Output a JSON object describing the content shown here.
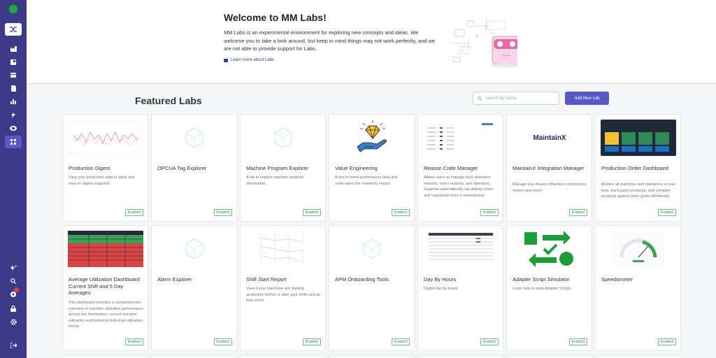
{
  "banner": {
    "title": "Welcome to MM Labs!",
    "text": "MM Labs is an experimental environment for exploring new concepts and ideas. We welcome you to take a look around, but keep in mind things may not work perfectly, and we are not able to provide support for Labs.",
    "learn_more": "Learn more about Labs"
  },
  "featured": {
    "title": "Featured Labs",
    "search_placeholder": "Search by Name",
    "add_button": "Add New Lab"
  },
  "colors": {
    "sidebar": "#3d3a8a",
    "accent": "#5a57c6",
    "enabled": "#2f8f4e"
  },
  "cards": [
    {
      "title": "Production Digest",
      "desc": "View your production data in quick and easy-to-digest snapshot.",
      "status": "Enabled"
    },
    {
      "title": "OPCUA Tag Explorer",
      "desc": "",
      "status": "Enabled"
    },
    {
      "title": "Machine Program Explorer",
      "desc": "A lab to explore machine program information.",
      "status": "Enabled"
    },
    {
      "title": "Value Engineering",
      "desc": "A tool to trend performance data and understand the monetary impact",
      "status": "Enabled"
    },
    {
      "title": "Reason Code Manager",
      "desc": "Allows users to manage their downtime reasons, reject reasons, and operators. Supports automatically calculating colors and copy/paste from a spreadsheet.",
      "status": "Enabled"
    },
    {
      "title": "MaintainX Integration Manager",
      "desc": "Manage your Asset&lt;&gt;Machine connections, meters and more!",
      "status": "Enabled"
    },
    {
      "title": "Production Order Dashboard",
      "desc": "Monitor all machines and operations in real-time, track parts produced, and compare progress against parts goals effortlessly.",
      "status": "Enabled"
    },
    {
      "title": "Average Utilization Dashboard: Current Shift and 5 Day Averages",
      "desc": "This dashboard provides a comprehensive overview of machine utilization performance across two timeframes: current real-time utilization and historical shift-level utilization trends",
      "status": "Enabled"
    },
    {
      "title": "Alarm Explorer",
      "desc": "",
      "status": "Enabled"
    },
    {
      "title": "Shift Start Report",
      "desc": "View if your machines are starting production before or after your shifts and by how much",
      "status": "Enabled"
    },
    {
      "title": "APM Onboarding Tools",
      "desc": "",
      "status": "Enabled"
    },
    {
      "title": "Day By Hours",
      "desc": "Digital day by board",
      "status": "Enabled"
    },
    {
      "title": "Adapter Script Simulator",
      "desc": "Learn how to write Adapter Scripts",
      "status": "Enabled"
    },
    {
      "title": "Speedometer",
      "desc": "",
      "status": "Enabled"
    }
  ],
  "thumb_labels": {
    "maintainx": "MaintainX"
  }
}
